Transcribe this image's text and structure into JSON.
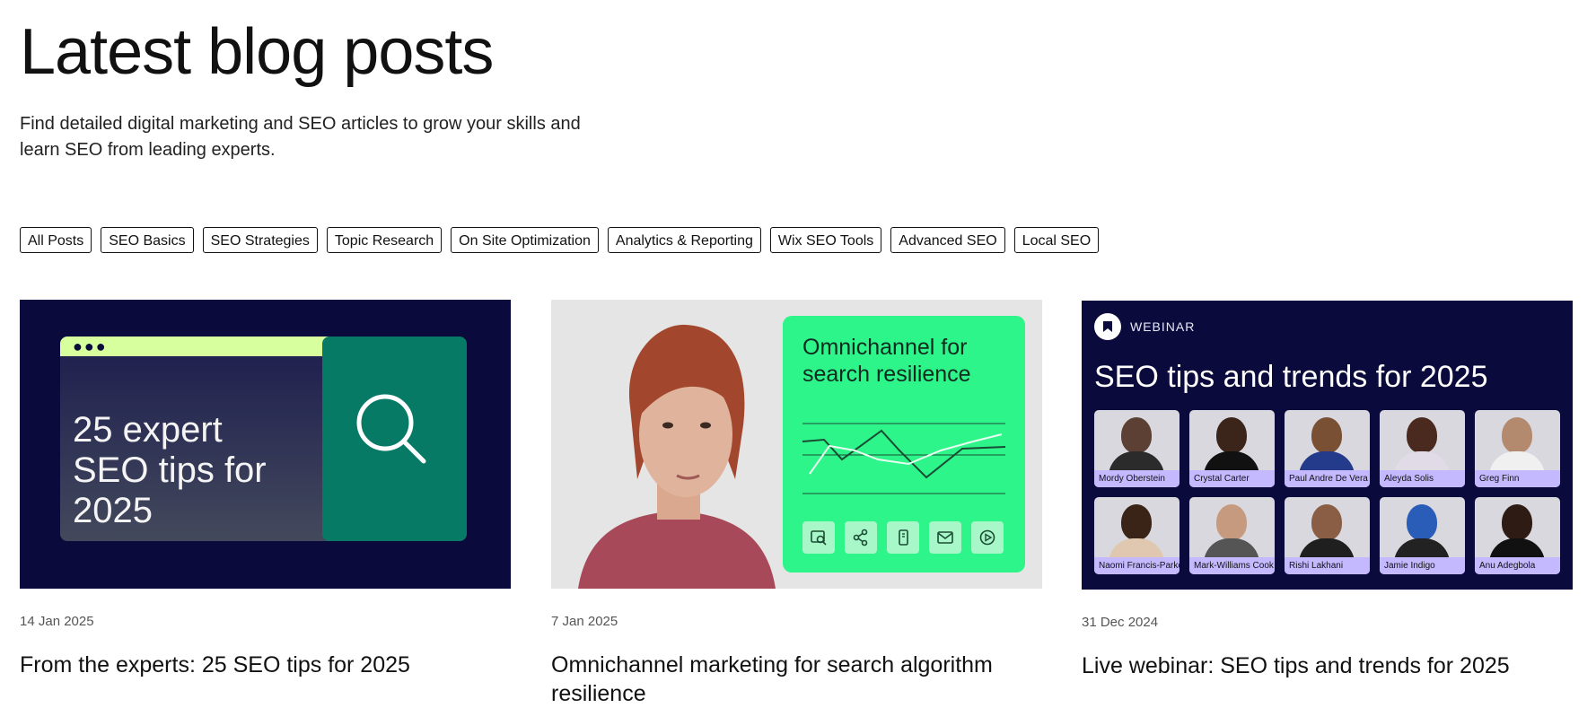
{
  "page": {
    "title": "Latest blog posts",
    "subtitle": "Find detailed digital marketing and SEO articles to grow your skills and learn SEO from leading experts."
  },
  "filters": [
    {
      "label": "All Posts"
    },
    {
      "label": "SEO Basics"
    },
    {
      "label": "SEO Strategies"
    },
    {
      "label": "Topic Research"
    },
    {
      "label": "On Site Optimization"
    },
    {
      "label": "Analytics & Reporting"
    },
    {
      "label": "Wix SEO Tools"
    },
    {
      "label": "Advanced SEO"
    },
    {
      "label": "Local SEO"
    }
  ],
  "posts": [
    {
      "date": "14 Jan 2025",
      "title": "From the experts: 25 SEO tips for 2025",
      "image_text": "25 expert SEO tips for 2025"
    },
    {
      "date": "7 Jan 2025",
      "title": "Omnichannel marketing for search algorithm resilience",
      "image_text": "Omnichannel for search resilience"
    },
    {
      "date": "31 Dec 2024",
      "title": "Live webinar: SEO tips and trends for 2025",
      "image_badge": "WEBINAR",
      "image_text": "SEO tips and trends for 2025",
      "speakers": [
        "Mordy Oberstein",
        "Crystal Carter",
        "Paul Andre De Vera",
        "Aleyda Solis",
        "Greg Finn",
        "Naomi Francis-Parker",
        "Mark-Williams Cook",
        "Rishi Lakhani",
        "Jamie Indigo",
        "Anu Adegbola"
      ]
    }
  ],
  "colors": {
    "navy": "#0a0a3c",
    "lime": "#d7ff9e",
    "teal": "#077a66",
    "mint": "#2ef58a",
    "lavender": "#c4b8ff"
  }
}
